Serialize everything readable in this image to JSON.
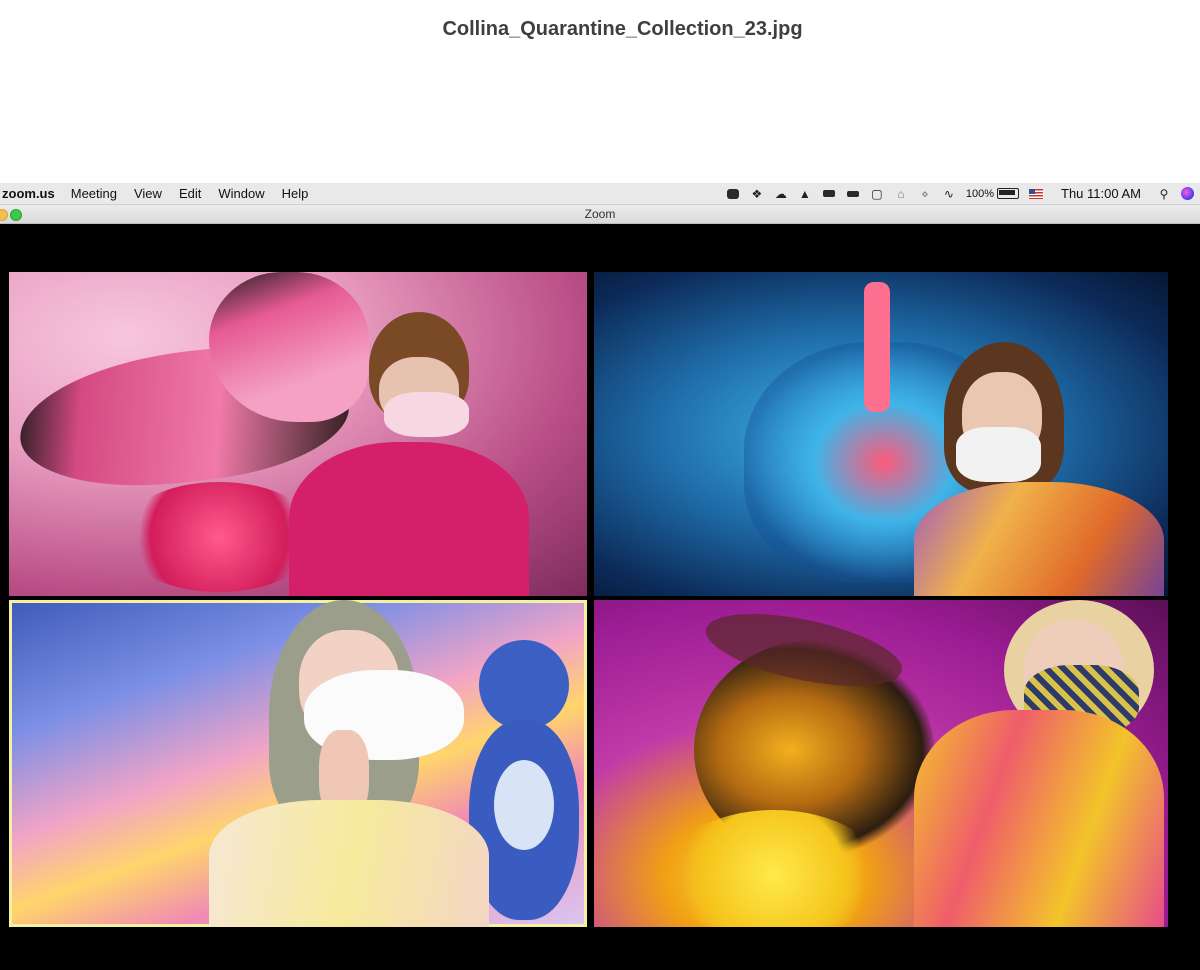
{
  "file": {
    "title": "Collina_Quarantine_Collection_23.jpg"
  },
  "menubar": {
    "app_name": "zoom.us",
    "items": [
      "Meeting",
      "View",
      "Edit",
      "Window",
      "Help"
    ],
    "battery": "100%",
    "clock": "Thu 11:00 AM",
    "status_icons": [
      "zoom-camera-icon",
      "dropbox-icon",
      "creative-cloud-icon",
      "notification-icon",
      "display-icon",
      "keyboard-icon",
      "screen-icon",
      "home-icon",
      "bluetooth-icon",
      "wifi-icon",
      "battery-icon",
      "us-flag-icon",
      "search-icon",
      "siri-icon"
    ]
  },
  "window": {
    "title": "Zoom"
  },
  "participants": [
    {
      "background": "butterfly",
      "active_speaker": false
    },
    {
      "background": "lungs",
      "active_speaker": false
    },
    {
      "background": "rainbow-bear",
      "active_speaker": true
    },
    {
      "background": "bee-on-flower",
      "active_speaker": false
    }
  ],
  "colors": {
    "active_border": "#f4f1a0",
    "window_bg": "#000000",
    "menubar_bg": "#e9e9ea"
  }
}
